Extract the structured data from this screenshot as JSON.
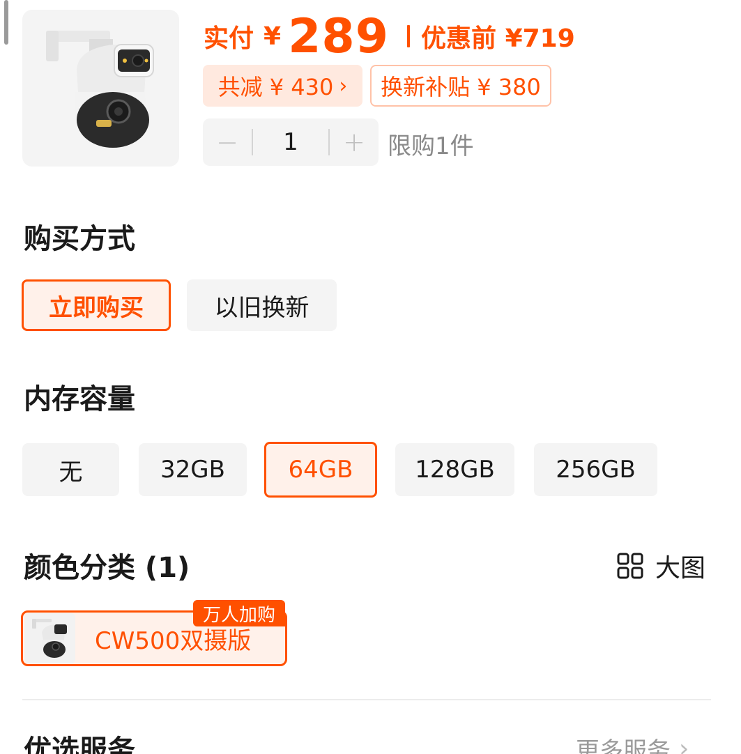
{
  "product": {
    "image_icon": "security-camera-image",
    "price_prefix": "实付",
    "currency": "¥",
    "price": "289",
    "original_price": "优惠前 ¥719",
    "discount_badge": "共减 ¥ 430",
    "discount_chevron": "›",
    "subsidy_badge": "换新补贴 ¥ 380",
    "quantity": "1",
    "qty_minus": "−",
    "qty_plus": "+",
    "purchase_limit": "限购1件"
  },
  "purchase_method": {
    "title": "购买方式",
    "options": [
      "立即购买",
      "以旧换新"
    ],
    "selected": "立即购买"
  },
  "storage": {
    "title": "内存容量",
    "options": [
      "无",
      "32GB",
      "64GB",
      "128GB",
      "256GB"
    ],
    "selected": "64GB"
  },
  "color": {
    "title": "颜色分类 (1)",
    "view_large_label": "大图",
    "view_large_icon": "grid-icon",
    "option_label": "CW500双摄版",
    "option_tag": "万人加购"
  },
  "services": {
    "title": "优选服务",
    "more_label": "更多服务",
    "more_chevron": "›"
  },
  "colors": {
    "accent": "#ff5000",
    "accent_light_bg": "#fff1ea",
    "option_bg": "#f4f4f4"
  }
}
